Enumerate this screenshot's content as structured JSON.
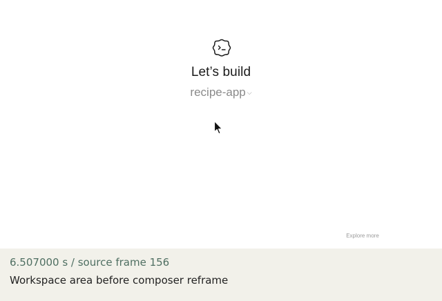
{
  "workspace": {
    "logo_icon": "smiley-badge-icon",
    "headline": "Let’s build",
    "project_name": "recipe-app",
    "project_chevron_icon": "chevron-down-icon",
    "cursor_icon": "mouse-pointer-icon",
    "explore_label": "Explore more"
  },
  "caption": {
    "timestamp": "6.507000 s / source frame 156",
    "description": "Workspace area before composer reframe"
  },
  "colors": {
    "caption_background": "#f2f1ea",
    "timestamp_text": "#4f6f62",
    "muted_text": "#8a8a8a"
  }
}
